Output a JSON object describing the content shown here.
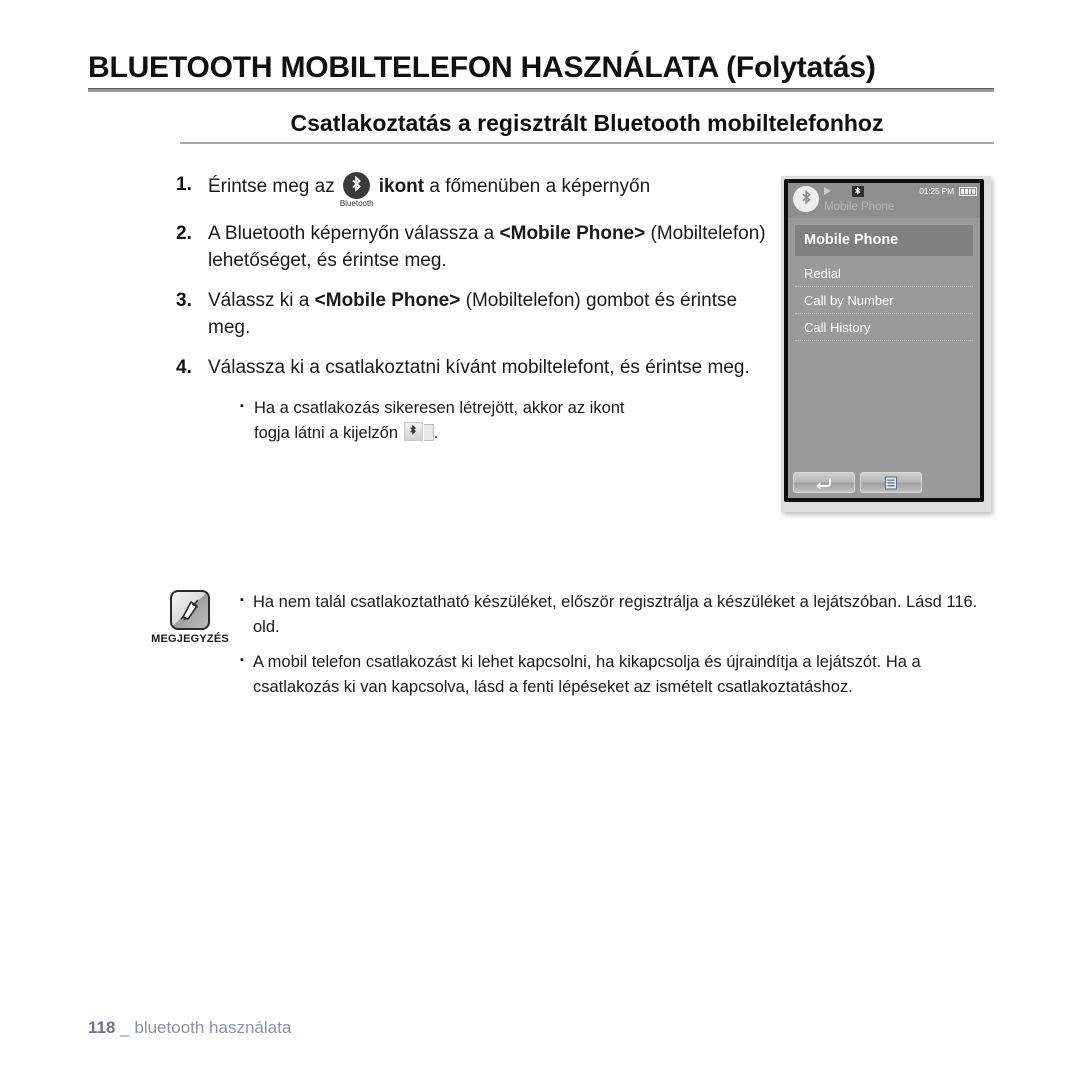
{
  "header": {
    "main_title": "BLUETOOTH MOBILTELEFON HASZNÁLATA (Folytatás)",
    "sub_title": "Csatlakoztatás a regisztrált Bluetooth mobiltelefonhoz"
  },
  "steps": [
    {
      "num": "1.",
      "text_before": "Érintse meg az",
      "icon_caption": "Bluetooth",
      "text_bold": "ikont",
      "text_after": "a főmenüben a képernyőn"
    },
    {
      "num": "2.",
      "part1": "A Bluetooth képernyőn válassza a ",
      "bold": "<Mobile Phone>",
      "part2": " (Mobiltelefon) lehetőséget, és érintse meg."
    },
    {
      "num": "3.",
      "part1": "Válassz ki a ",
      "bold": "<Mobile Phone>",
      "part2": " (Mobiltelefon) gombot és érintse meg."
    },
    {
      "num": "4.",
      "part1": "Válassza ki a csatlakoztatni kívánt mobiltelefont, és érintse meg."
    }
  ],
  "sub_bullet": {
    "marker": "▪",
    "line1": "Ha a csatlakozás sikeresen létrejött, akkor az ikont",
    "line2": "fogja látni a kijelzőn",
    "trailing": "."
  },
  "note": {
    "icon_label": "MEGJEGYZÉS",
    "marker": "▪",
    "items": [
      "Ha nem talál csatlakoztatható készüléket, először regisztrálja a készüléket a lejátszóban. Lásd 116. old.",
      "A mobil telefon csatlakozást ki lehet kapcsolni, ha kikapcsolja és újraindítja a lejátszót. Ha a csatlakozás ki van kapcsolva, lásd a fenti lépéseket az ismételt csatlakoztatáshoz."
    ]
  },
  "device": {
    "status": {
      "time": "01:25 PM",
      "battery_bars": 4,
      "play_icon": "play-icon",
      "bt_phone_icon": "bluetooth-phone-icon"
    },
    "badge_icon": "bluetooth-icon",
    "screen_title": "Mobile Phone",
    "menu": [
      {
        "label": "Mobile Phone",
        "selected": true
      },
      {
        "label": "Redial",
        "selected": false
      },
      {
        "label": "Call by Number",
        "selected": false
      },
      {
        "label": "Call History",
        "selected": false
      }
    ],
    "softkeys": [
      {
        "name": "back-softkey",
        "icon": "return-arrow-icon"
      },
      {
        "name": "menu-softkey",
        "icon": "list-menu-icon"
      }
    ]
  },
  "footer": {
    "page_number": "118",
    "separator": "_",
    "section": "bluetooth használata"
  },
  "colors": {
    "screen_bg": "#9a9a9a",
    "screen_selected": "#808080",
    "bezel": "#0d0d0d",
    "footer_text": "#8c8fa8",
    "rule": "#9a9a9a"
  }
}
